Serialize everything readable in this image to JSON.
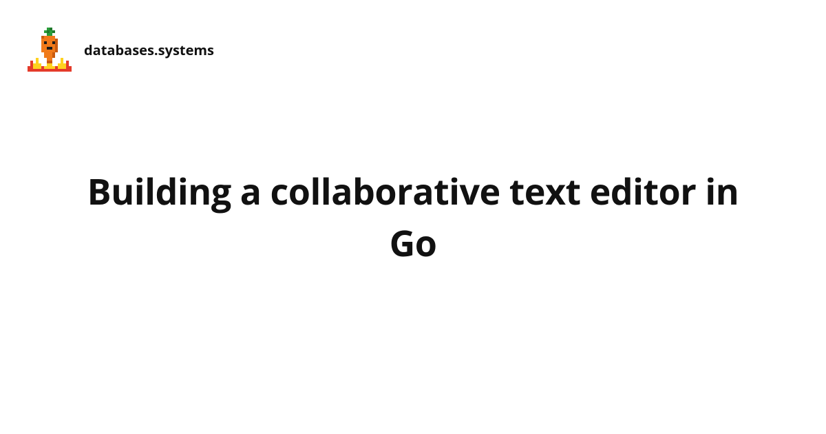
{
  "header": {
    "site_name": "databases.systems"
  },
  "main": {
    "title": "Building a collaborative text editor in Go"
  },
  "logo": {
    "colors": {
      "carrot_body": "#f07a1a",
      "carrot_dark": "#c95a0e",
      "leaf": "#2a9d3a",
      "leaf_dark": "#1f7a2c",
      "fire_yellow": "#ffd21f",
      "fire_red": "#e43b2a",
      "face": "#1a1a1a"
    }
  }
}
